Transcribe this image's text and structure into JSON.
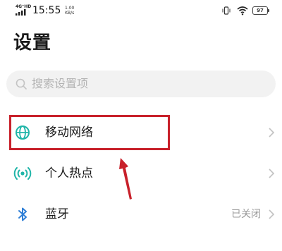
{
  "status_bar": {
    "network_type": "4G⁺HD",
    "time": "15:55",
    "speed_value": "1.00",
    "speed_unit": "KB/s",
    "battery": "97"
  },
  "page": {
    "title": "设置"
  },
  "search": {
    "placeholder": "搜索设置项"
  },
  "items": [
    {
      "label": "移动网络",
      "icon": "globe-icon",
      "value": ""
    },
    {
      "label": "个人热点",
      "icon": "hotspot-icon",
      "value": ""
    },
    {
      "label": "蓝牙",
      "icon": "bluetooth-icon",
      "value": "已关闭"
    }
  ],
  "colors": {
    "icon_accent": "#1fb5a8",
    "bluetooth_accent": "#2f7fd6",
    "annotation_red": "#c8212b"
  }
}
